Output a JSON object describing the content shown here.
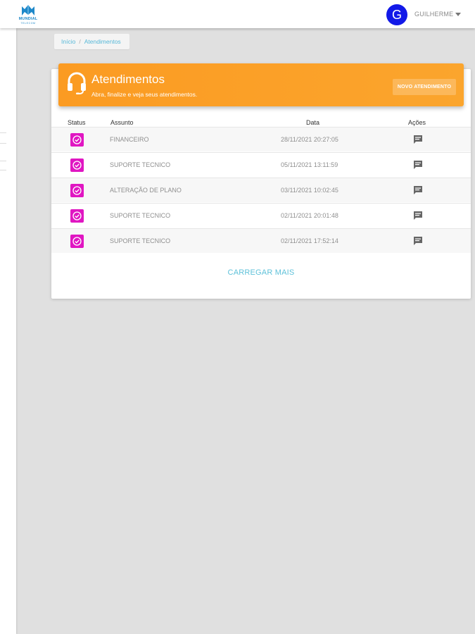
{
  "brand": {
    "name": "MUNDIAL",
    "sub": "TELECOM",
    "color": "#1e88c9"
  },
  "user": {
    "initial": "G",
    "name": "GUILHERME",
    "avatar_color": "#1219e8",
    "menu_icon": "caret-down-icon"
  },
  "breadcrumb": {
    "home": "Início",
    "separator": "/",
    "current": "Atendimentos"
  },
  "banner": {
    "icon": "headset-icon",
    "title": "Atendimentos",
    "subtitle": "Abra, finalize e veja seus atendimentos.",
    "button_label": "NOVO ATENDIMENTO",
    "color": "#fb9b22"
  },
  "table": {
    "headers": {
      "status": "Status",
      "subject": "Assunto",
      "date": "Data",
      "actions": "Ações"
    },
    "status_color": "#e016c2",
    "status_icon": "check-circle-icon",
    "action_icon": "comment-icon",
    "rows": [
      {
        "subject": "FINANCEIRO",
        "date": "28/11/2021 20:27:05"
      },
      {
        "subject": "SUPORTE TECNICO",
        "date": "05/11/2021 13:11:59"
      },
      {
        "subject": "ALTERAÇÃO DE PLANO",
        "date": "03/11/2021 10:02:45"
      },
      {
        "subject": "SUPORTE TECNICO",
        "date": "02/11/2021 20:01:48"
      },
      {
        "subject": "SUPORTE TECNICO",
        "date": "02/11/2021 17:52:14"
      }
    ]
  },
  "load_more": "CARREGAR MAIS"
}
